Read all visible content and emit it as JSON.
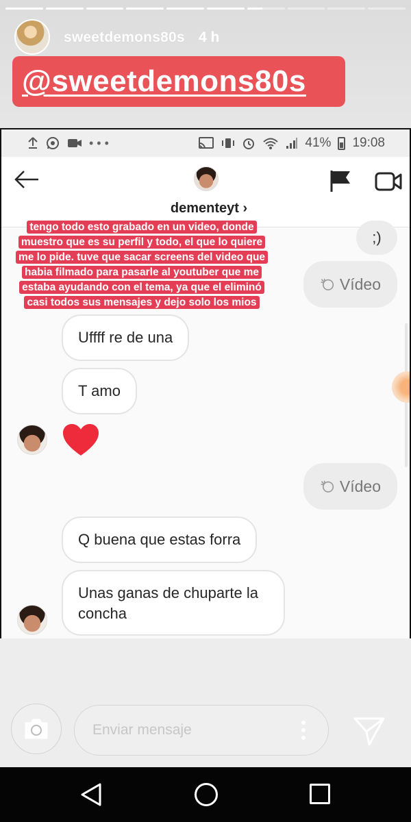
{
  "story": {
    "username": "sweetdemons80s",
    "time": "4 h",
    "mention": "@sweetdemons80s",
    "progress_segments": 10,
    "active_segment": 7,
    "message_placeholder": "Enviar mensaje"
  },
  "statusbar": {
    "battery": "41%",
    "time": "19:08"
  },
  "dm": {
    "username": "dementeyt",
    "chevron": "›"
  },
  "caption": "tengo todo esto grabado en un video, donde muestro que es su perfil y todo, el que lo quiere me lo pide. tuve que sacar screens del video que habia filmado para pasarle al youtuber que me estaba ayudando con el tema, ya que el eliminó casi todos sus mensajes y dejo solo los mios",
  "messages": {
    "wink": ";)",
    "video_1": "Vídeo",
    "m1": "Uffff re de una",
    "m2": "T amo",
    "video_2": "Vídeo",
    "m3": "Q buena que estas forra",
    "m4": "Unas ganas de chuparte la concha"
  },
  "colors": {
    "mention_bg": "#e95257",
    "caption_bg": "#e33e55",
    "heart": "#ed2b3a"
  }
}
